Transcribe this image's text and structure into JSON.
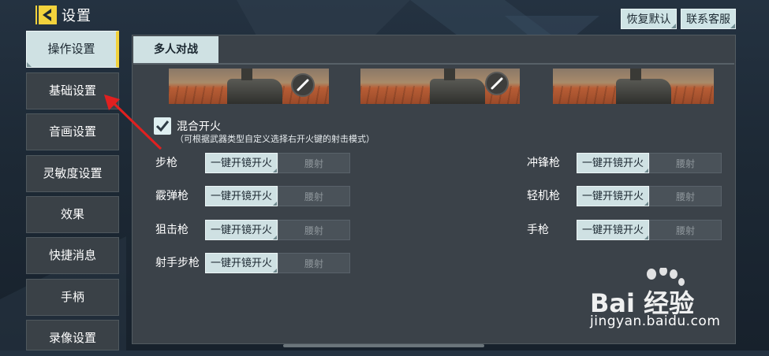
{
  "header": {
    "title": "设置",
    "restore_default": "恢复默认",
    "contact_support": "联系客服"
  },
  "sidebar": {
    "items": [
      {
        "label": "操作设置",
        "active": true
      },
      {
        "label": "基础设置",
        "active": false
      },
      {
        "label": "音画设置",
        "active": false
      },
      {
        "label": "灵敏度设置",
        "active": false
      },
      {
        "label": "效果",
        "active": false
      },
      {
        "label": "快捷消息",
        "active": false
      },
      {
        "label": "手柄",
        "active": false
      },
      {
        "label": "录像设置",
        "active": false
      }
    ]
  },
  "main": {
    "tab": "多人对战",
    "mixed_fire": {
      "label": "混合开火",
      "hint": "（可根据武器类型自定义选择右开火键的射击模式）",
      "checked": true
    },
    "option_a": "一键开镜开火",
    "option_b": "腰射",
    "weapons_left": [
      "步枪",
      "霰弹枪",
      "狙击枪",
      "射手步枪"
    ],
    "weapons_right": [
      "冲锋枪",
      "轻机枪",
      "手枪"
    ]
  },
  "watermark": {
    "brand": "Bai 经验",
    "url": "jingyan.baidu.com"
  },
  "colors": {
    "accent_yellow": "#f2d23c",
    "selected_bg": "#cfe1e3",
    "annotation_red": "#e02020"
  }
}
